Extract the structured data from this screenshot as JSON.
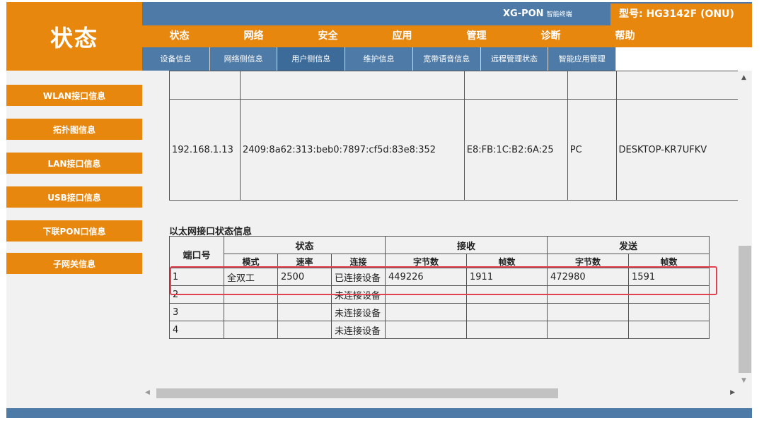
{
  "status_box": {
    "label": "状态"
  },
  "sidebar": {
    "items": [
      {
        "label": "WLAN接口信息"
      },
      {
        "label": "拓扑图信息"
      },
      {
        "label": "LAN接口信息"
      },
      {
        "label": "USB接口信息"
      },
      {
        "label": "下联PON口信息"
      },
      {
        "label": "子网关信息"
      }
    ]
  },
  "header": {
    "product": "XG-PON",
    "product_sub": "智能终端",
    "model": "型号: HG3142F (ONU)"
  },
  "menu": {
    "items": [
      {
        "label": "状态"
      },
      {
        "label": "网络"
      },
      {
        "label": "安全"
      },
      {
        "label": "应用"
      },
      {
        "label": "管理"
      },
      {
        "label": "诊断"
      },
      {
        "label": "帮助"
      }
    ]
  },
  "submenu": {
    "items": [
      {
        "label": "设备信息"
      },
      {
        "label": "网络侧信息"
      },
      {
        "label": "用户侧信息"
      },
      {
        "label": "维护信息"
      },
      {
        "label": "宽带语音信息"
      },
      {
        "label": "远程管理状态"
      },
      {
        "label": "智能应用管理"
      }
    ]
  },
  "clients": {
    "rows": [
      {
        "ipv4": "192.168.1.13",
        "ipv6": "2409:8a62:313:beb0:7897:cf5d:83e8:352",
        "mac": "E8:FB:1C:B2:6A:25",
        "type": "PC",
        "name": "DESKTOP-KR7UFKV"
      }
    ]
  },
  "eth": {
    "title": "以太网接口状态信息",
    "headers": {
      "port": "端口号",
      "status": "状态",
      "rx": "接收",
      "tx": "发送",
      "mode": "模式",
      "rate": "速率",
      "link": "连接",
      "rx_bytes": "字节数",
      "rx_frames": "帧数",
      "tx_bytes": "字节数",
      "tx_frames": "帧数"
    },
    "rows": [
      {
        "port": "1",
        "mode": "全双工",
        "rate": "2500",
        "link": "已连接设备",
        "rx_bytes": "449226",
        "rx_frames": "1911",
        "tx_bytes": "472980",
        "tx_frames": "1591"
      },
      {
        "port": "2",
        "mode": "",
        "rate": "",
        "link": "未连接设备",
        "rx_bytes": "",
        "rx_frames": "",
        "tx_bytes": "",
        "tx_frames": ""
      },
      {
        "port": "3",
        "mode": "",
        "rate": "",
        "link": "未连接设备",
        "rx_bytes": "",
        "rx_frames": "",
        "tx_bytes": "",
        "tx_frames": ""
      },
      {
        "port": "4",
        "mode": "",
        "rate": "",
        "link": "未连接设备",
        "rx_bytes": "",
        "rx_frames": "",
        "tx_bytes": "",
        "tx_frames": ""
      }
    ]
  },
  "icons": {
    "scroll_up": "▲",
    "scroll_down": "▼",
    "scroll_left": "◀",
    "scroll_right": "▶"
  },
  "colors": {
    "orange": "#e8870e",
    "blue": "#4d7aa6",
    "highlight": "#e0434f"
  }
}
